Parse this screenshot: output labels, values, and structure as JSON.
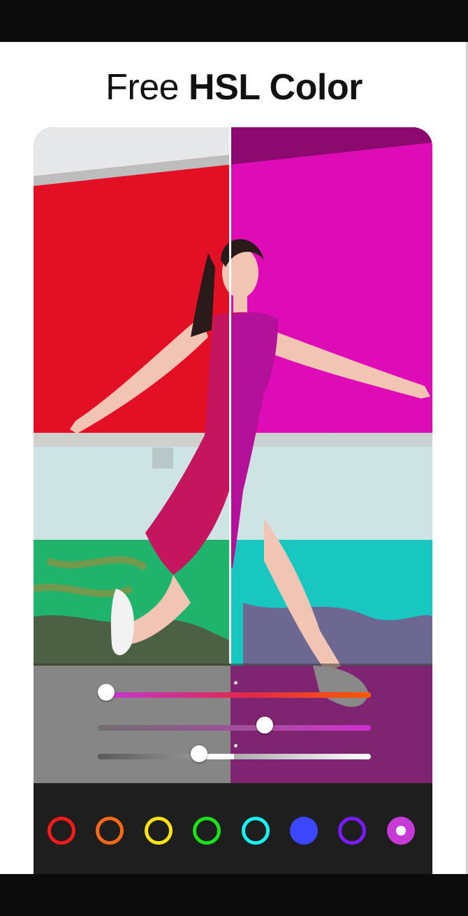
{
  "headline": {
    "regular": "Free ",
    "bold": "HSL Color"
  },
  "hsl_panel": {
    "hue_value": 0.03,
    "saturation_value": 0.61,
    "luminance_value": 0.37
  },
  "swatches": [
    {
      "name": "red",
      "color": "#ff1a1a",
      "style": "ring",
      "selected": false
    },
    {
      "name": "orange",
      "color": "#ff6a1a",
      "style": "ring",
      "selected": false
    },
    {
      "name": "yellow",
      "color": "#ffe21a",
      "style": "ring",
      "selected": false
    },
    {
      "name": "green",
      "color": "#1ae21a",
      "style": "ring",
      "selected": false
    },
    {
      "name": "aqua",
      "color": "#1af0f0",
      "style": "ring",
      "selected": false
    },
    {
      "name": "blue",
      "color": "#3c46ff",
      "style": "filled",
      "selected": false
    },
    {
      "name": "purple",
      "color": "#7a1aff",
      "style": "ring",
      "selected": false
    },
    {
      "name": "magenta",
      "color": "#c63ad6",
      "style": "filled",
      "selected": true
    }
  ]
}
